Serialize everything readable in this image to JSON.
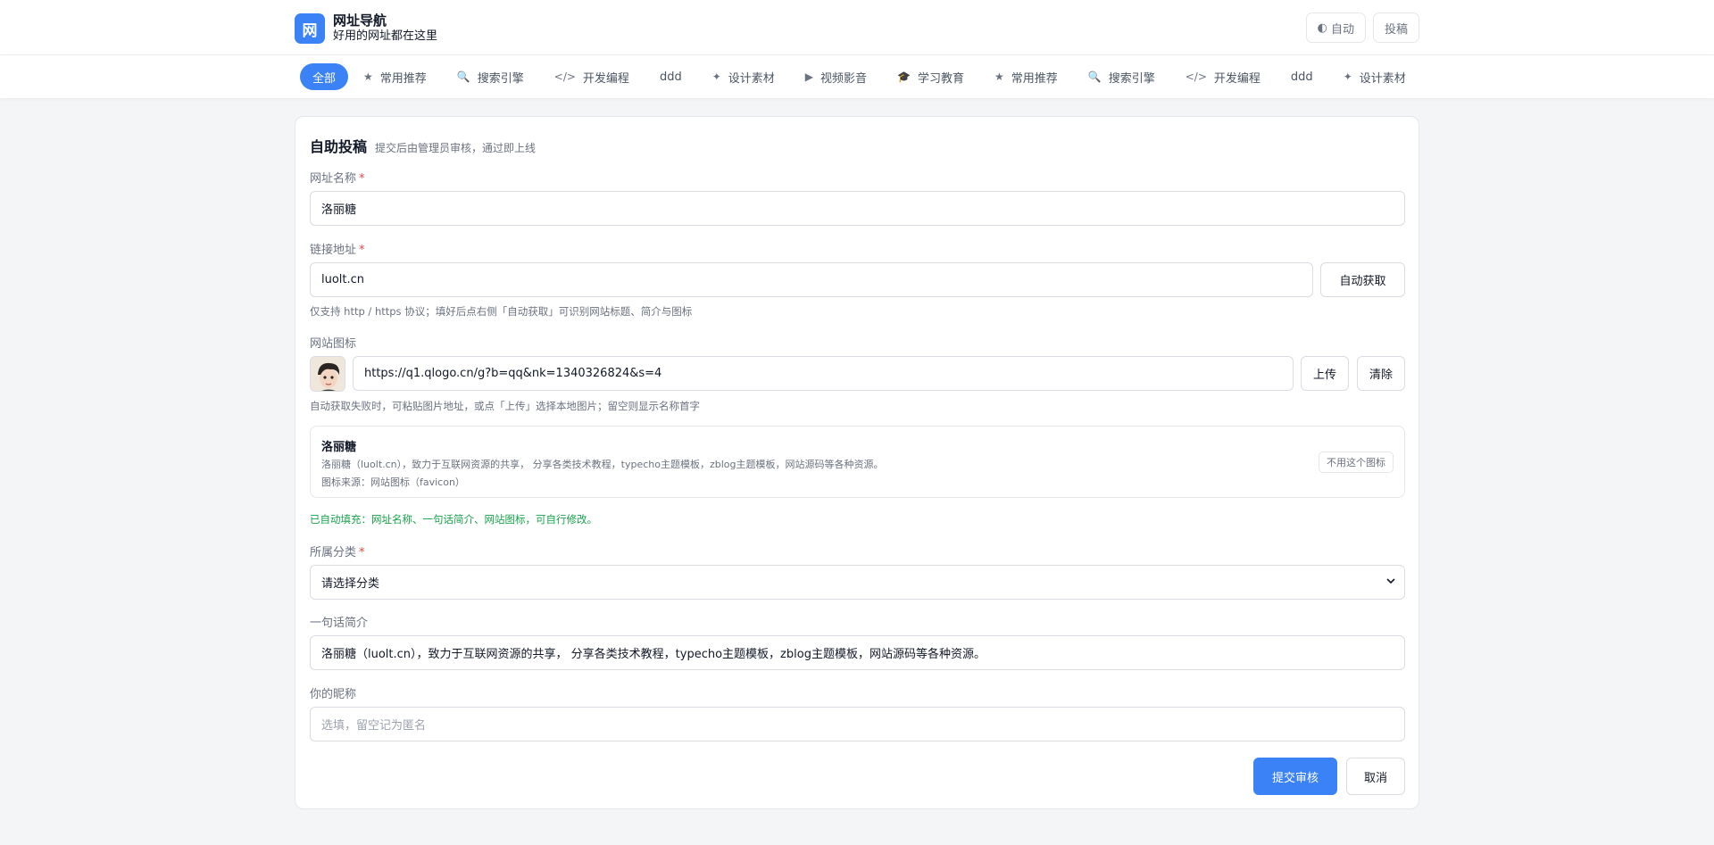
{
  "header": {
    "logo_char": "网",
    "title": "网址导航",
    "subtitle": "好用的网址都在这里",
    "theme_icon": "◐",
    "theme_label": "自动",
    "submit_label": "投稿"
  },
  "nav": [
    {
      "icon": "",
      "label": "全部",
      "active": true
    },
    {
      "icon": "★",
      "label": "常用推荐"
    },
    {
      "icon": "🔍",
      "label": "搜索引擎"
    },
    {
      "icon": "</>",
      "label": "开发编程"
    },
    {
      "icon": "",
      "label": "ddd"
    },
    {
      "icon": "✦",
      "label": "设计素材"
    },
    {
      "icon": "▶",
      "label": "视频影音"
    },
    {
      "icon": "🎓",
      "label": "学习教育"
    },
    {
      "icon": "★",
      "label": "常用推荐"
    },
    {
      "icon": "🔍",
      "label": "搜索引擎"
    },
    {
      "icon": "</>",
      "label": "开发编程"
    },
    {
      "icon": "",
      "label": "ddd"
    },
    {
      "icon": "✦",
      "label": "设计素材"
    }
  ],
  "form": {
    "title": "自助投稿",
    "subtitle": "提交后由管理员审核，通过即上线",
    "required_mark": "*",
    "name_label": "网址名称",
    "name_value": "洛丽糖",
    "url_label": "链接地址",
    "url_value": "luolt.cn",
    "auto_fetch_label": "自动获取",
    "url_hint": "仅支持 http / https 协议；填好后点右侧「自动获取」可识别网站标题、简介与图标",
    "icon_label": "网站图标",
    "icon_value": "https://q1.qlogo.cn/g?b=qq&nk=1340326824&s=4",
    "upload_label": "上传",
    "clear_label": "清除",
    "icon_hint": "自动获取失败时，可粘贴图片地址，或点「上传」选择本地图片；留空则显示名称首字",
    "preview": {
      "name": "洛丽糖",
      "desc": "洛丽糖（luolt.cn），致力于互联网资源的共享， 分享各类技术教程，typecho主题模板，zblog主题模板，网站源码等各种资源。",
      "source": "图标来源：网站图标（favicon）",
      "reject_label": "不用这个图标"
    },
    "autofill_note": "已自动填充：网址名称、一句话简介、网站图标，可自行修改。",
    "category_label": "所属分类",
    "category_value": "请选择分类",
    "intro_label": "一句话简介",
    "intro_value": "洛丽糖（luolt.cn），致力于互联网资源的共享， 分享各类技术教程，typecho主题模板，zblog主题模板，网站源码等各种资源。",
    "nickname_label": "你的昵称",
    "nickname_placeholder": "选填，留空记为匿名",
    "submit_label": "提交审核",
    "cancel_label": "取消"
  },
  "colors": {
    "accent": "#3b82f6",
    "required": "#ef4444",
    "success": "#16a34a"
  },
  "icons": {
    "theme": "half-circle-icon",
    "select": "chevron-down-icon"
  }
}
